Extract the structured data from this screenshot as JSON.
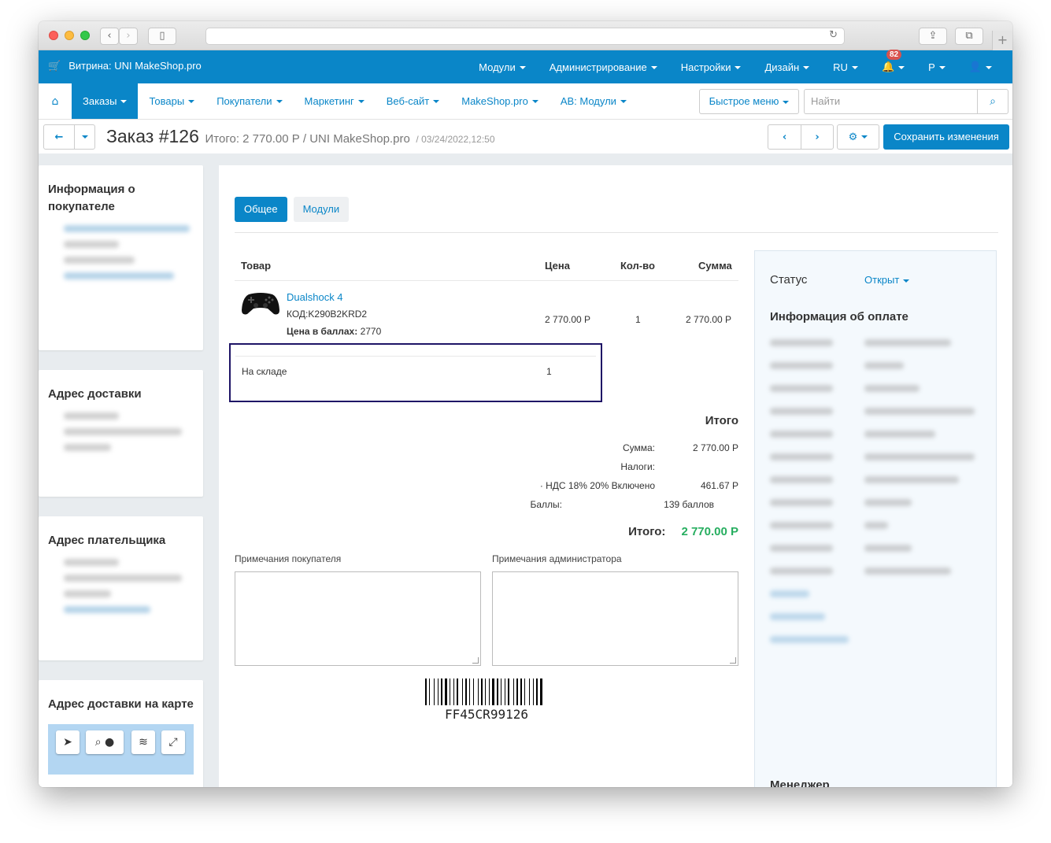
{
  "topnav": {
    "brand": "Витрина: UNI MakeShop.pro",
    "menu": [
      "Модули",
      "Администрирование",
      "Настройки",
      "Дизайн",
      "RU",
      "",
      "Р",
      ""
    ],
    "notifications": "82"
  },
  "subnav": {
    "items": [
      "Заказы",
      "Товары",
      "Покупатели",
      "Маркетинг",
      "Веб-сайт",
      "MakeShop.pro",
      "АВ: Модули"
    ],
    "quick_menu": "Быстрое меню",
    "search_placeholder": "Найти"
  },
  "header": {
    "title": "Заказ #126",
    "subtitle": "Итого: 2 770.00 Р / UNI MakeShop.pro",
    "date": "/ 03/24/2022,12:50",
    "save": "Сохранить изменения"
  },
  "sidebar": {
    "customer": "Информация о покупателе",
    "shipping": "Адрес доставки",
    "billing": "Адрес плательщика",
    "map": "Адрес доставки на карте"
  },
  "tabs": [
    "Общее",
    "Модули"
  ],
  "table": {
    "headers": [
      "Товар",
      "Цена",
      "Кол-во",
      "Сумма"
    ],
    "product": {
      "name": "Dualshock 4",
      "code": "КОД:K290B2KRD2",
      "points_label": "Цена в баллах:",
      "points_value": "2770",
      "price": "2 770.00 Р",
      "qty": "1",
      "sum": "2 770.00 Р"
    },
    "stock": {
      "label": "На складе",
      "value": "1"
    }
  },
  "totals": {
    "heading": "Итого",
    "rows": [
      {
        "k": "Сумма:",
        "v": "2 770.00 Р"
      },
      {
        "k": "Налоги:",
        "v": ""
      },
      {
        "k": "· НДС 18% 20% Включено",
        "v": "461.67 Р"
      },
      {
        "k": "Баллы:",
        "v": "139 баллов"
      }
    ],
    "grand_label": "Итого:",
    "grand_value": "2 770.00 Р"
  },
  "notes": {
    "customer": "Примечания покупателя",
    "admin": "Примечания администратора"
  },
  "barcode": "FF45CR99126",
  "right": {
    "status_label": "Статус",
    "status_value": "Открыт",
    "payment": "Информация об оплате",
    "manager": "Менеджер"
  }
}
